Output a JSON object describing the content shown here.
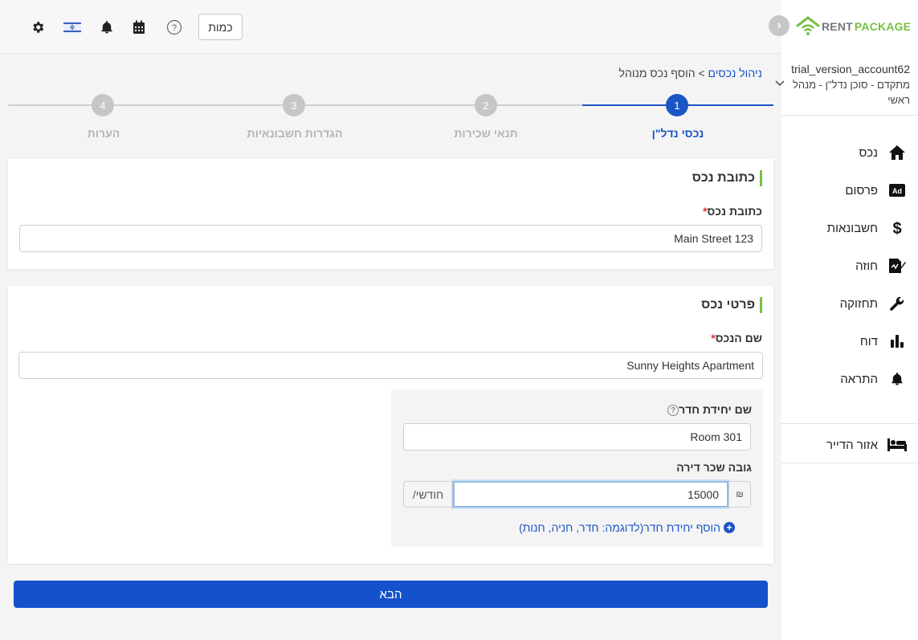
{
  "topbar": {
    "quantity_label": "כמות",
    "icons": [
      "gear-icon",
      "flag-icon",
      "bell-icon",
      "calendar-icon",
      "help-icon"
    ]
  },
  "sidebar": {
    "logo": {
      "text1": "RENT",
      "text2": "PACKAGE"
    },
    "account": {
      "name": "trial_version_account62",
      "role": "מתקדם - סוכן נדל\"ן - מנהל ראשי"
    },
    "items": [
      {
        "label": "נכס",
        "icon": "home-icon"
      },
      {
        "label": "פרסום",
        "icon": "ad-icon"
      },
      {
        "label": "חשבונאות",
        "icon": "dollar-icon"
      },
      {
        "label": "חוזה",
        "icon": "contract-icon"
      },
      {
        "label": "תחזוקה",
        "icon": "wrench-icon"
      },
      {
        "label": "דוח",
        "icon": "chart-icon"
      },
      {
        "label": "התראה",
        "icon": "bell-icon"
      }
    ],
    "tenant_area": {
      "label": "אזור הדייר",
      "icon": "bed-icon"
    }
  },
  "breadcrumb": {
    "parent": "ניהול נכסים",
    "separator": ">",
    "current": "הוסף נכס מנוהל"
  },
  "stepper": {
    "steps": [
      {
        "number": "1",
        "label": "נכסי נדל\"ן",
        "active": true
      },
      {
        "number": "2",
        "label": "תנאי שכירות",
        "active": false
      },
      {
        "number": "3",
        "label": "הגדרות חשבונאיות",
        "active": false
      },
      {
        "number": "4",
        "label": "הערות",
        "active": false
      }
    ]
  },
  "address_section": {
    "title": "כתובת נכס",
    "field_label": "כתובת נכס",
    "required_mark": "*",
    "value": "Main Street 123"
  },
  "details_section": {
    "title": "פרטי נכס",
    "name_label": "שם הנכס",
    "required_mark": "*",
    "name_value": "Sunny Heights Apartment",
    "unit_name_label": "שם יחידת חדר",
    "unit_name_value": "Room 301",
    "rent_label": "גובה שכר דירה",
    "rent_value": "15000",
    "currency_symbol": "₪",
    "rent_period": "/חודשי",
    "add_unit_label": "הוסף יחידת חדר(לדוגמה: חדר, חניה, חנות)"
  },
  "next_button": "הבא",
  "colors": {
    "primary": "#1a55c4",
    "accent_green": "#76c043",
    "required_red": "#e0323c"
  }
}
